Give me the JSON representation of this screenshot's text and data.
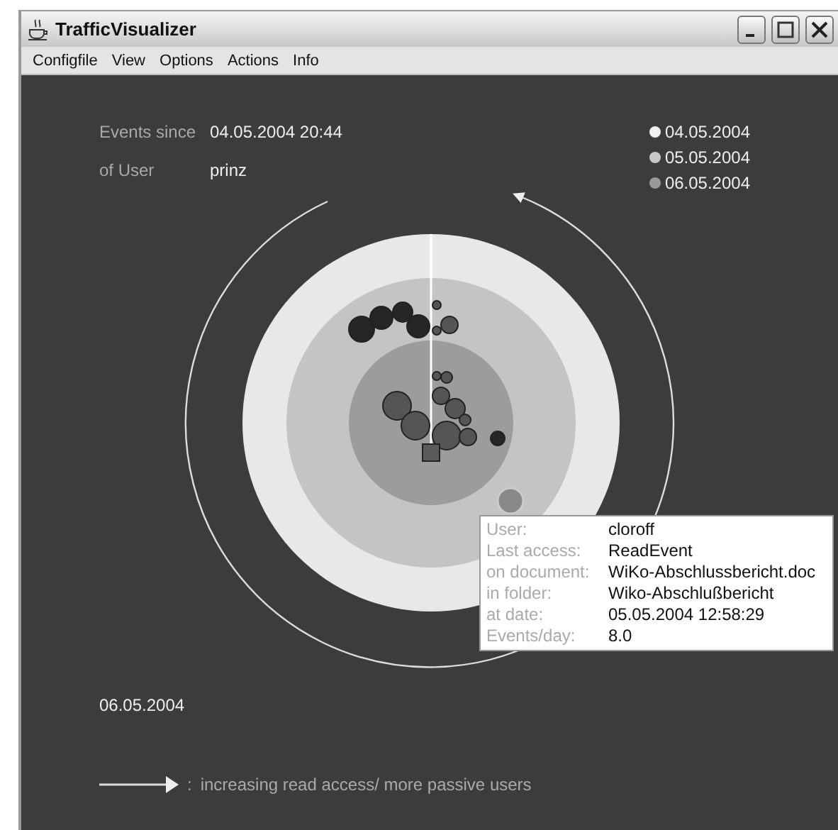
{
  "window": {
    "title": "TrafficVisualizer"
  },
  "menu": [
    "Configfile",
    "View",
    "Options",
    "Actions",
    "Info"
  ],
  "header": {
    "events_since_label": "Events since",
    "events_since_value": "04.05.2004 20:44",
    "user_label": "of User",
    "user_value": "prinz"
  },
  "legend": [
    {
      "label": "04.05.2004",
      "color": "#f0f0f0"
    },
    {
      "label": "05.05.2004",
      "color": "#c8c8c8"
    },
    {
      "label": "06.05.2004",
      "color": "#999999"
    }
  ],
  "tooltip": [
    {
      "label": "User:",
      "value": "cloroff"
    },
    {
      "label": "Last access:",
      "value": "ReadEvent"
    },
    {
      "label": "on document:",
      "value": "WiKo-Abschlussbericht.doc"
    },
    {
      "label": "in folder:",
      "value": "Wiko-Abschlußbericht"
    },
    {
      "label": "at date:",
      "value": "05.05.2004 12:58:29"
    },
    {
      "label": "Events/day:",
      "value": "8.0"
    }
  ],
  "current_date": "06.05.2004",
  "footer": {
    "separator": ":",
    "text": "increasing read access/ more passive users"
  }
}
